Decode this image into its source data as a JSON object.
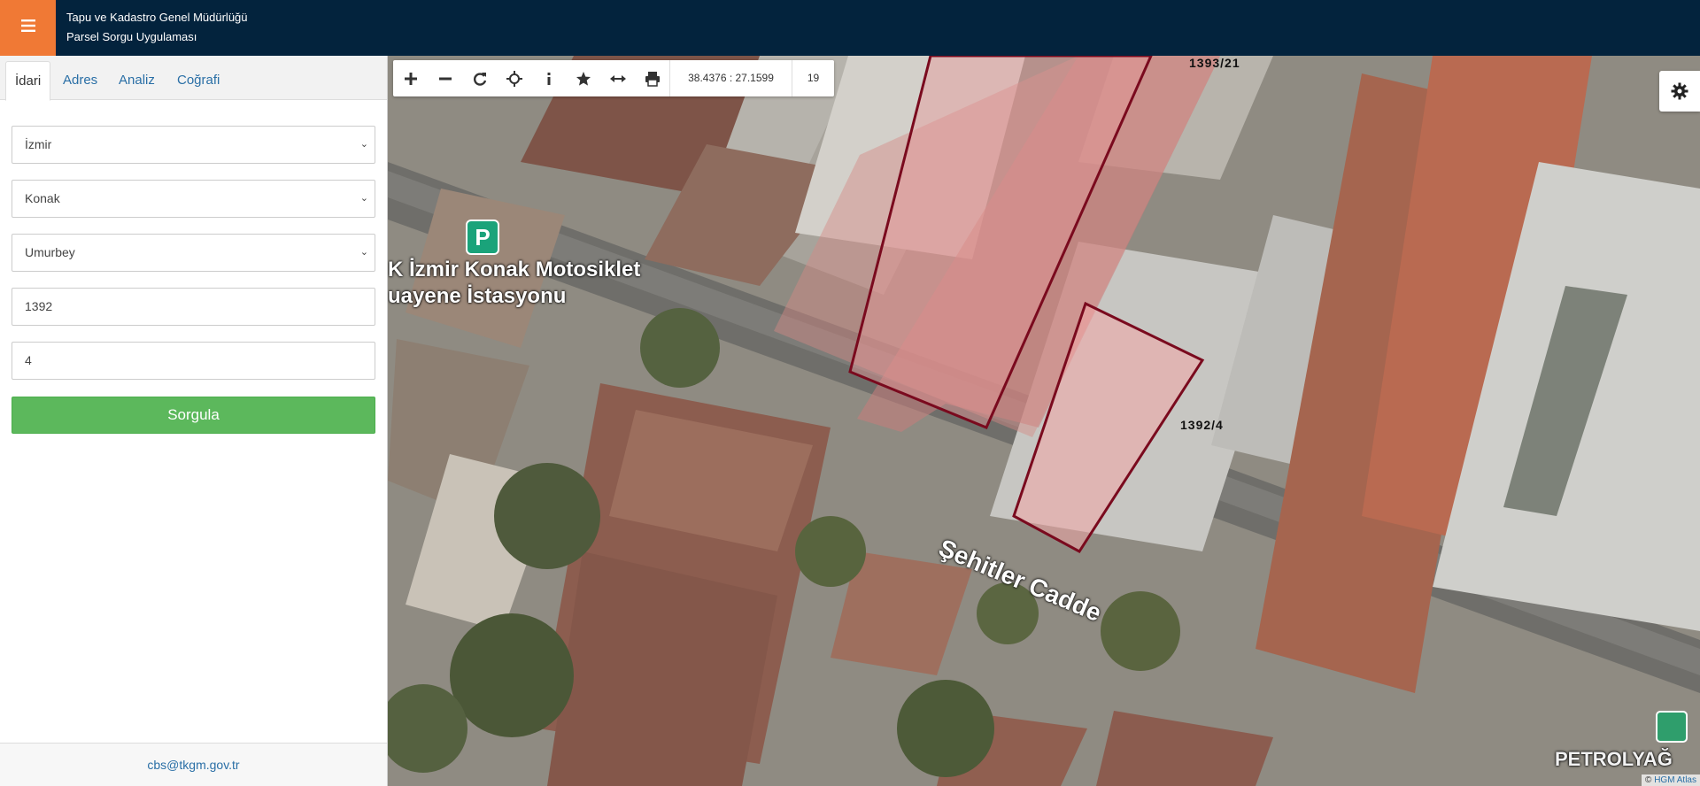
{
  "header": {
    "org_name": "Tapu ve Kadastro Genel Müdürlüğü",
    "app_name": "Parsel Sorgu Uygulaması",
    "menu_icon": "hamburger-icon",
    "accent_color": "#f07935",
    "bar_color": "#03233d"
  },
  "sidebar": {
    "tabs": [
      {
        "label": "İdari",
        "active": true
      },
      {
        "label": "Adres",
        "active": false
      },
      {
        "label": "Analiz",
        "active": false
      },
      {
        "label": "Coğrafi",
        "active": false
      }
    ],
    "province": "İzmir",
    "district": "Konak",
    "neighborhood": "Umurbey",
    "block_no": "1392",
    "parcel_no": "4",
    "query_button": "Sorgula",
    "footer_email": "cbs@tkgm.gov.tr"
  },
  "map": {
    "toolbar_icons": [
      "zoom-in-icon",
      "zoom-out-icon",
      "refresh-icon",
      "locate-icon",
      "info-icon",
      "favorite-icon",
      "measure-icon",
      "print-icon"
    ],
    "coordinates": "38.4376 : 27.1599",
    "zoom_level": "19",
    "parcel_labels": [
      "1393/21",
      "1392/4"
    ],
    "place_labels": [
      "K İzmir Konak Motosiklet",
      "uayene İstasyonu"
    ],
    "street_label": "Şehitler Cadde",
    "poi_label": "PETROLYAĞ",
    "attribution_prefix": "©",
    "attribution_link": "HGM Atlas",
    "parcel_stroke_color": "#7a0a1e"
  }
}
